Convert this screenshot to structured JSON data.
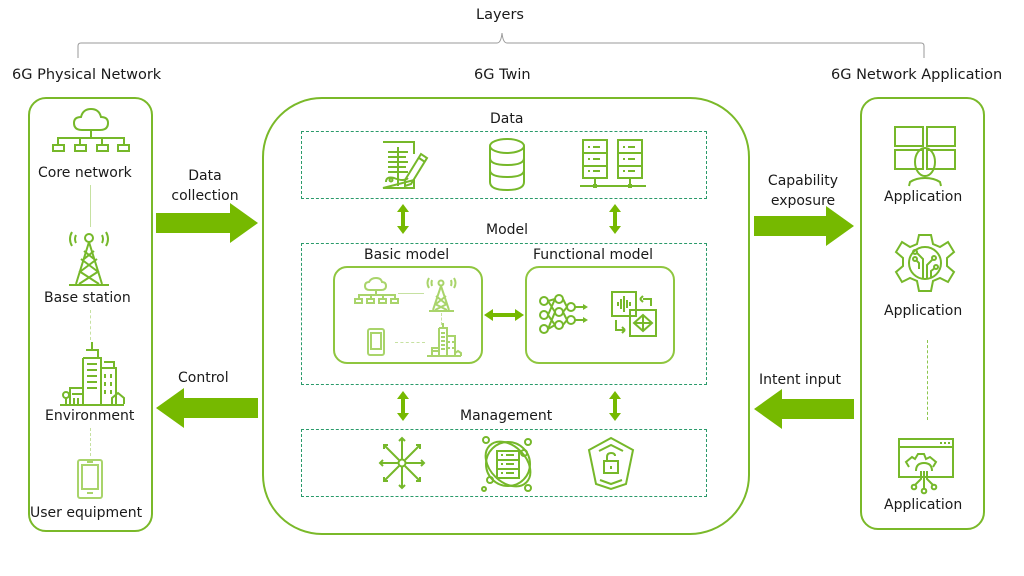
{
  "header": {
    "layers_label": "Layers"
  },
  "columns": {
    "physical": {
      "title": "6G Physical Network",
      "items": [
        {
          "label": "Core network",
          "icon": "core-network-icon"
        },
        {
          "label": "Base station",
          "icon": "base-station-icon"
        },
        {
          "label": "Environment",
          "icon": "city-environment-icon"
        },
        {
          "label": "User equipment",
          "icon": "mobile-phone-icon"
        }
      ]
    },
    "twin": {
      "title": "6G Twin",
      "data": {
        "label": "Data",
        "icons": [
          "document-edit-icon",
          "database-icon",
          "server-rack-icon"
        ]
      },
      "model": {
        "label": "Model",
        "basic": {
          "label": "Basic model",
          "icons": [
            "core-network-icon",
            "base-station-icon",
            "mobile-phone-icon",
            "city-environment-icon"
          ]
        },
        "functional": {
          "label": "Functional model",
          "icons": [
            "neural-network-icon",
            "signal-ai-loop-icon"
          ]
        }
      },
      "management": {
        "label": "Management",
        "icons": [
          "distribution-hub-icon",
          "orbit-server-icon",
          "security-unlock-icon"
        ]
      }
    },
    "application": {
      "title": "6G Network Application",
      "items": [
        {
          "label": "Application",
          "icon": "dashboard-user-icon"
        },
        {
          "label": "Application",
          "icon": "gear-circuit-icon"
        },
        {
          "label": "Application",
          "icon": "browser-gear-icon"
        }
      ]
    }
  },
  "flows": {
    "data_collection": {
      "line1": "Data",
      "line2": "collection",
      "direction": "right"
    },
    "control": {
      "label": "Control",
      "direction": "left"
    },
    "capability_exposure": {
      "line1": "Capability",
      "line2": "exposure",
      "direction": "right"
    },
    "intent_input": {
      "label": "Intent input",
      "direction": "left"
    }
  },
  "colors": {
    "accent": "#76b900",
    "dashed_border": "#2a9a6a",
    "text": "#1a1a1a"
  }
}
